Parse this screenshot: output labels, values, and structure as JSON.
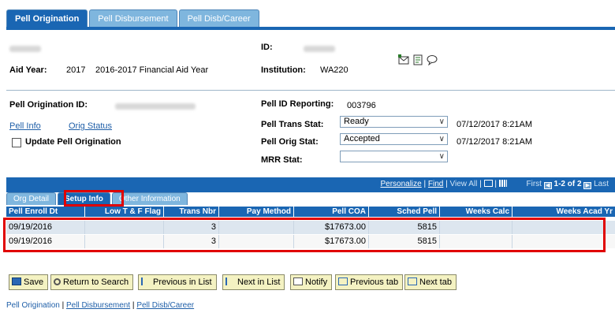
{
  "tabs": [
    {
      "label": "Pell Origination"
    },
    {
      "label": "Pell Disbursement"
    },
    {
      "label": "Pell Disb/Career"
    }
  ],
  "header": {
    "id_label": "ID:",
    "aid_year_label": "Aid Year:",
    "aid_year_value": "2017",
    "aid_year_desc": "2016-2017 Financial Aid Year",
    "institution_label": "Institution:",
    "institution_value": "WA220"
  },
  "origination": {
    "pell_orig_id_label": "Pell Origination ID:",
    "pell_info_link": "Pell Info",
    "orig_status_link": "Orig Status",
    "update_label": "Update Pell Origination",
    "id_reporting_label": "Pell ID Reporting:",
    "id_reporting_value": "003796",
    "trans_stat_label": "Pell Trans Stat:",
    "trans_stat_value": "Ready",
    "trans_stat_date": "07/12/2017  8:21AM",
    "orig_stat_label": "Pell Orig Stat:",
    "orig_stat_value": "Accepted",
    "orig_stat_date": "07/12/2017  8:21AM",
    "mrr_stat_label": "MRR Stat:",
    "mrr_stat_value": ""
  },
  "grid": {
    "personalize": "Personalize",
    "find": "Find",
    "view_all": "View All",
    "first": "First",
    "range": "1-2 of 2",
    "last": "Last",
    "subtabs": [
      {
        "label": "Org Detail"
      },
      {
        "label": "Setup Info"
      },
      {
        "label": "Other Information"
      }
    ],
    "columns": [
      "Pell Enroll Dt",
      "Low T & F Flag",
      "Trans Nbr",
      "Pay Method",
      "Pell COA",
      "Sched Pell",
      "Weeks Calc",
      "Weeks Acad Yr"
    ],
    "rows": [
      {
        "enroll_dt": "09/19/2016",
        "low_flag": "",
        "trans_nbr": "3",
        "pay_method": "",
        "coa": "$17673.00",
        "sched": "5815",
        "weeks_calc": "",
        "weeks_acad": ""
      },
      {
        "enroll_dt": "09/19/2016",
        "low_flag": "",
        "trans_nbr": "3",
        "pay_method": "",
        "coa": "$17673.00",
        "sched": "5815",
        "weeks_calc": "",
        "weeks_acad": ""
      }
    ]
  },
  "buttons": {
    "save": "Save",
    "return": "Return to Search",
    "prev_list": "Previous in List",
    "next_list": "Next in List",
    "notify": "Notify",
    "prev_tab": "Previous tab",
    "next_tab": "Next tab"
  },
  "footer": {
    "current": "Pell Origination",
    "link1": "Pell Disbursement",
    "link2": "Pell Disb/Career"
  }
}
